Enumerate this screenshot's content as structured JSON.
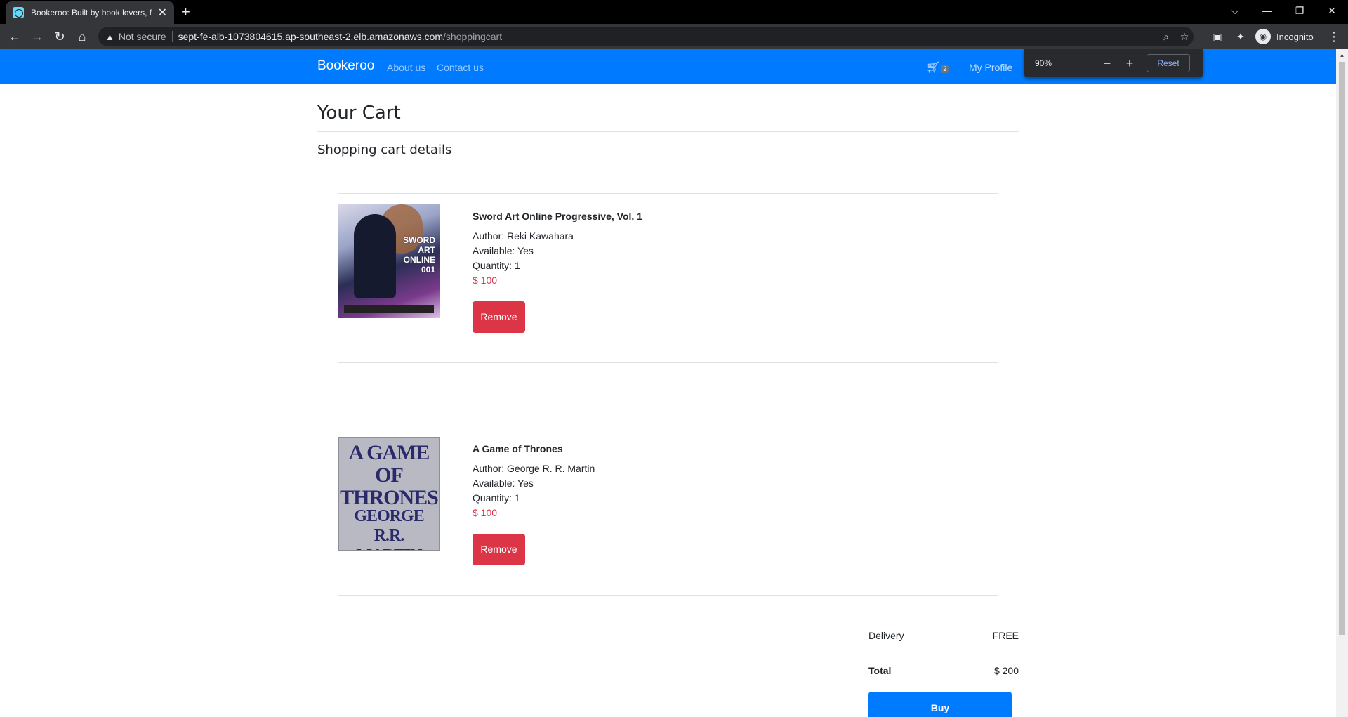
{
  "browser": {
    "tab_title": "Bookeroo: Built by book lovers, f",
    "new_tab": "+",
    "not_secure": "Not secure",
    "url_host": "sept-fe-alb-1073804615.ap-southeast-2.elb.amazonaws.com",
    "url_path": "/shoppingcart",
    "profile_label": "Incognito",
    "zoom_level": "90%",
    "zoom_reset": "Reset"
  },
  "navbar": {
    "brand": "Bookeroo",
    "links": [
      "About us",
      "Contact us"
    ],
    "cart_count": "2",
    "profile": "My Profile"
  },
  "page": {
    "title": "Your Cart",
    "subtitle": "Shopping cart details"
  },
  "cart": {
    "items": [
      {
        "title": "Sword Art Online Progressive, Vol. 1",
        "author": "Author: Reki Kawahara",
        "available": "Available: Yes",
        "quantity": "Quantity: 1",
        "price": "$ 100",
        "remove_label": "Remove"
      },
      {
        "title": "A Game of Thrones",
        "author": "Author: George R. R. Martin",
        "available": "Available: Yes",
        "quantity": "Quantity: 1",
        "price": "$ 100",
        "remove_label": "Remove"
      }
    ]
  },
  "summary": {
    "delivery_label": "Delivery",
    "delivery_value": "FREE",
    "total_label": "Total",
    "total_value": "$ 200",
    "buy_label": "Buy"
  }
}
